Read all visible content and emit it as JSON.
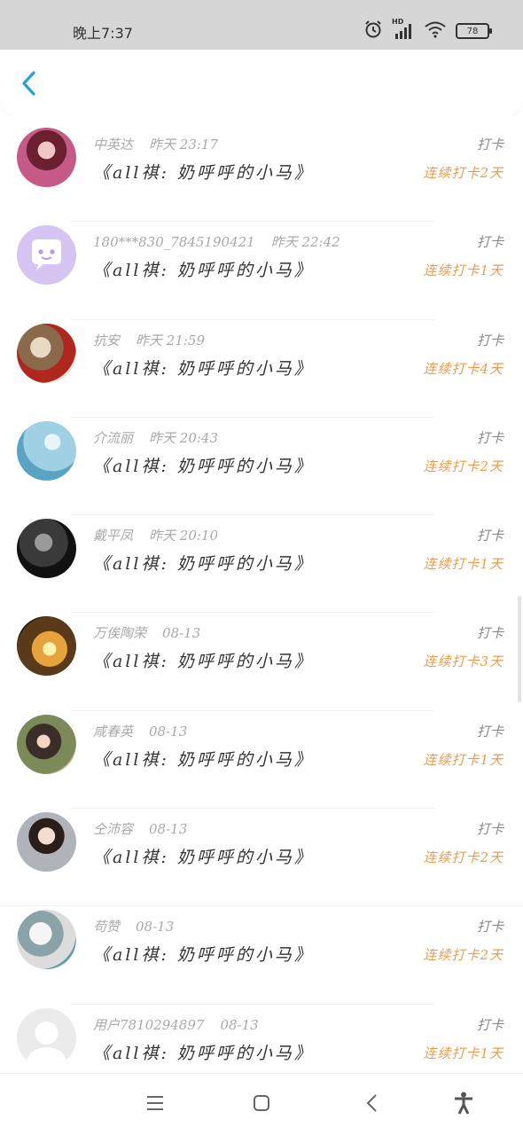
{
  "status_bar": {
    "time": "晚上7:37",
    "battery": "78",
    "signal_label": "HD"
  },
  "header": {
    "back_icon": "chevron-left-icon",
    "accent_color": "#2a9fe0"
  },
  "entries": [
    {
      "name": "中英达",
      "time": "昨天 23:17",
      "title": "《all祺: 奶呼呼的小马》",
      "action": "打卡",
      "streak": "连续打卡2天",
      "avatar": "photo"
    },
    {
      "name": "180***830_7845190421",
      "time": "昨天 22:42",
      "title": "《all祺: 奶呼呼的小马》",
      "action": "打卡",
      "streak": "连续打卡1天",
      "avatar": "default-chat"
    },
    {
      "name": "抗安",
      "time": "昨天 21:59",
      "title": "《all祺: 奶呼呼的小马》",
      "action": "打卡",
      "streak": "连续打卡4天",
      "avatar": "photo"
    },
    {
      "name": "介流丽",
      "time": "昨天 20:43",
      "title": "《all祺: 奶呼呼的小马》",
      "action": "打卡",
      "streak": "连续打卡2天",
      "avatar": "photo"
    },
    {
      "name": "戴平凤",
      "time": "昨天 20:10",
      "title": "《all祺: 奶呼呼的小马》",
      "action": "打卡",
      "streak": "连续打卡1天",
      "avatar": "photo"
    },
    {
      "name": "万俟陶荣",
      "time": "08-13",
      "title": "《all祺: 奶呼呼的小马》",
      "action": "打卡",
      "streak": "连续打卡3天",
      "avatar": "photo"
    },
    {
      "name": "咸春英",
      "time": "08-13",
      "title": "《all祺: 奶呼呼的小马》",
      "action": "打卡",
      "streak": "连续打卡1天",
      "avatar": "photo"
    },
    {
      "name": "仝沛容",
      "time": "08-13",
      "title": "《all祺: 奶呼呼的小马》",
      "action": "打卡",
      "streak": "连续打卡2天",
      "avatar": "photo"
    },
    {
      "name": "苟赞",
      "time": "08-13",
      "title": "《all祺: 奶呼呼的小马》",
      "action": "打卡",
      "streak": "连续打卡2天",
      "avatar": "photo"
    },
    {
      "name": "用户7810294897",
      "time": "08-13",
      "title": "《all祺: 奶呼呼的小马》",
      "action": "打卡",
      "streak": "连续打卡1天",
      "avatar": "default-person"
    }
  ],
  "navbar": {
    "menu_icon": "menu-icon",
    "home_icon": "home-square-icon",
    "back_icon": "back-triangle-icon",
    "accessibility_icon": "accessibility-icon"
  },
  "colors": {
    "streak": "#f19a4a",
    "meta": "#a9a9a9",
    "title": "#333333"
  }
}
